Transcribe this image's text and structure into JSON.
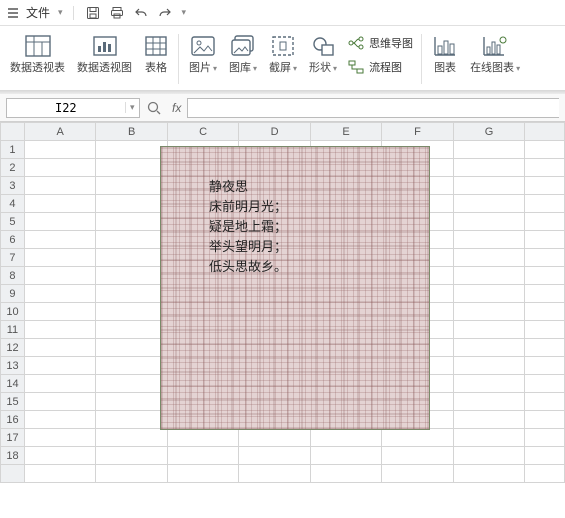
{
  "titlebar": {
    "menu_label": "文件"
  },
  "ribbon": {
    "pivot_table": "数据透视表",
    "pivot_chart": "数据透视图",
    "table": "表格",
    "picture": "图片",
    "gallery": "图库",
    "screenshot": "截屏",
    "shape": "形状",
    "mindmap": "思维导图",
    "flowchart": "流程图",
    "chart": "图表",
    "online_chart": "在线图表"
  },
  "formula_bar": {
    "name_box_value": "I22"
  },
  "grid": {
    "columns": [
      "A",
      "B",
      "C",
      "D",
      "E",
      "F",
      "G",
      ""
    ],
    "rows": [
      "1",
      "2",
      "3",
      "4",
      "5",
      "6",
      "7",
      "8",
      "9",
      "10",
      "11",
      "12",
      "13",
      "14",
      "15",
      "16",
      "17",
      "18",
      ""
    ]
  },
  "textbox": {
    "title": "静夜思",
    "line1": "床前明月光；",
    "line2": "疑是地上霜；",
    "line3": "举头望明月；",
    "line4": "低头思故乡。"
  }
}
